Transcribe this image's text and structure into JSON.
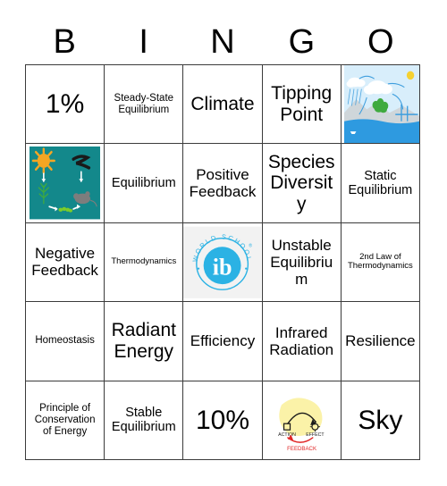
{
  "header": {
    "letters": [
      "B",
      "I",
      "N",
      "G",
      "O"
    ]
  },
  "grid": {
    "columns": 5,
    "rows": 5,
    "border_color": "#3b3b3b",
    "background_color": "#ffffff"
  },
  "cells": [
    {
      "row": 1,
      "col": 1,
      "type": "text",
      "text": "1%",
      "size": "fs-xxl"
    },
    {
      "row": 1,
      "col": 2,
      "type": "text",
      "text": "Steady-State Equilibrium",
      "size": "fs-sm"
    },
    {
      "row": 1,
      "col": 3,
      "type": "text",
      "text": "Climate",
      "size": "fs-xl"
    },
    {
      "row": 1,
      "col": 4,
      "type": "text",
      "text": "Tipping Point",
      "size": "fs-xl"
    },
    {
      "row": 1,
      "col": 5,
      "type": "image",
      "image": "water-cycle-diagram",
      "alt": "Water cycle diagram with clouds, evaporation, condensation, precipitation over land and ocean",
      "labels": [
        "Evaporation",
        "Condensation",
        "Precipitation"
      ],
      "colors": {
        "sky": "#d8eefb",
        "ocean": "#2e9ae0",
        "cloud": "#ffffff",
        "land": "#cfd6da",
        "tree": "#3faa3f",
        "sun": "#f5d131",
        "arrow": "#3e9ede"
      }
    },
    {
      "row": 2,
      "col": 1,
      "type": "image",
      "image": "food-chain-diagram",
      "alt": "Food chain on teal background: sun, plant, caterpillar, mouse, snake connected by white arrows",
      "colors": {
        "background": "#13888b",
        "sun": "#f5a623",
        "plant": "#3faa3f",
        "caterpillar": "#7ccc2a",
        "mouse": "#7d7d7d",
        "snake": "#1a1a1a",
        "arrow": "#ffffff"
      }
    },
    {
      "row": 2,
      "col": 2,
      "type": "text",
      "text": "Equilibrium",
      "size": "fs-md"
    },
    {
      "row": 2,
      "col": 3,
      "type": "text",
      "text": "Positive Feedback",
      "size": "fs-lg"
    },
    {
      "row": 2,
      "col": 4,
      "type": "text",
      "text": "Species Diversity",
      "size": "fs-xl"
    },
    {
      "row": 2,
      "col": 5,
      "type": "text",
      "text": "Static Equilibrium",
      "size": "fs-md"
    },
    {
      "row": 3,
      "col": 1,
      "type": "text",
      "text": "Negative Feedback",
      "size": "fs-lg"
    },
    {
      "row": 3,
      "col": 2,
      "type": "text",
      "text": "Thermodynamics",
      "size": "fs-xs"
    },
    {
      "row": 3,
      "col": 3,
      "type": "image",
      "image": "ib-world-school-logo",
      "alt": "IB World School logo: cyan circle with lowercase ib and arc text WORLD SCHOOL",
      "labels": [
        "WORLD SCHOOL",
        "ib",
        "®"
      ],
      "colors": {
        "brand": "#2bb2e4",
        "background": "#f2f2f2",
        "mark_text": "#ffffff"
      }
    },
    {
      "row": 3,
      "col": 4,
      "type": "text",
      "text": "Unstable Equilibrium",
      "size": "fs-lg"
    },
    {
      "row": 3,
      "col": 5,
      "type": "text",
      "text": "2nd Law of Thermodynamics",
      "size": "fs-xs"
    },
    {
      "row": 4,
      "col": 1,
      "type": "text",
      "text": "Homeostasis",
      "size": "fs-sm"
    },
    {
      "row": 4,
      "col": 2,
      "type": "text",
      "text": "Radiant Energy",
      "size": "fs-xl"
    },
    {
      "row": 4,
      "col": 3,
      "type": "text",
      "text": "Efficiency",
      "size": "fs-lg"
    },
    {
      "row": 4,
      "col": 4,
      "type": "text",
      "text": "Infrared Radiation",
      "size": "fs-lg"
    },
    {
      "row": 4,
      "col": 5,
      "type": "text",
      "text": "Resilience",
      "size": "fs-lg"
    },
    {
      "row": 5,
      "col": 1,
      "type": "text",
      "text": "Principle of Conservation of Energy",
      "size": "fs-sm"
    },
    {
      "row": 5,
      "col": 2,
      "type": "text",
      "text": "Stable Equilibrium",
      "size": "fs-md"
    },
    {
      "row": 5,
      "col": 3,
      "type": "text",
      "text": "10%",
      "size": "fs-xxl"
    },
    {
      "row": 5,
      "col": 4,
      "type": "image",
      "image": "feedback-loop-sketch",
      "alt": "Hand drawn feedback loop: ACTION arrow to EFFECT with red FEEDBACK arrow returning, on yellow highlight",
      "labels": [
        "ACTION",
        "EFFECT",
        "FEEDBACK"
      ],
      "colors": {
        "highlight": "#fbf2a8",
        "ink": "#1a1a1a",
        "feedback": "#e02424"
      }
    },
    {
      "row": 5,
      "col": 5,
      "type": "text",
      "text": "Sky",
      "size": "fs-xxl"
    }
  ]
}
